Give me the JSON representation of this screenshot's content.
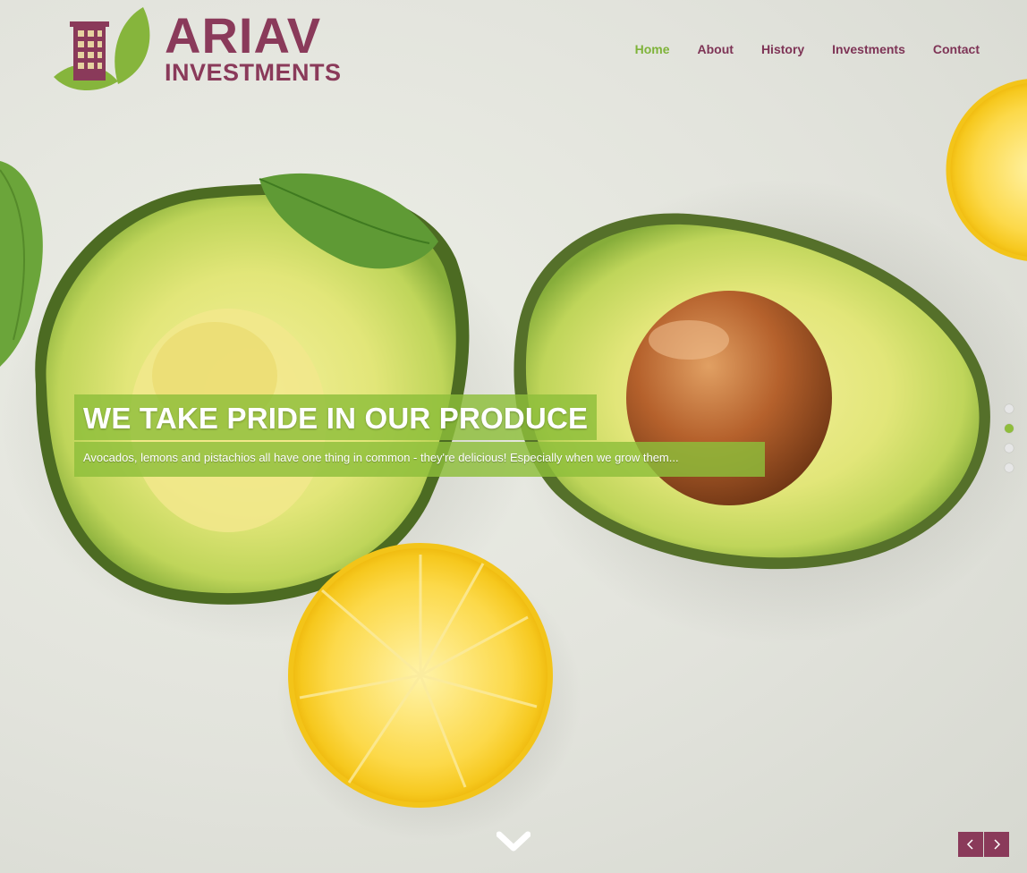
{
  "brand": {
    "name_line1": "ARIAV",
    "name_line2": "INVESTMENTS",
    "color_purple": "#8a3a5a",
    "color_green": "#7eb339"
  },
  "nav": {
    "items": [
      {
        "label": "Home",
        "active": true
      },
      {
        "label": "About",
        "active": false
      },
      {
        "label": "History",
        "active": false
      },
      {
        "label": "Investments",
        "active": false
      },
      {
        "label": "Contact",
        "active": false
      }
    ]
  },
  "slide": {
    "title": "WE TAKE PRIDE IN OUR PRODUCE",
    "subtitle": "Avocados, lemons and pistachios all have one thing in common - they're delicious! Especially when we grow them..."
  },
  "slider": {
    "dots": [
      false,
      true,
      false,
      false
    ],
    "prev_icon": "chevron-left-icon",
    "next_icon": "chevron-right-icon",
    "scroll_icon": "chevron-down-icon"
  }
}
